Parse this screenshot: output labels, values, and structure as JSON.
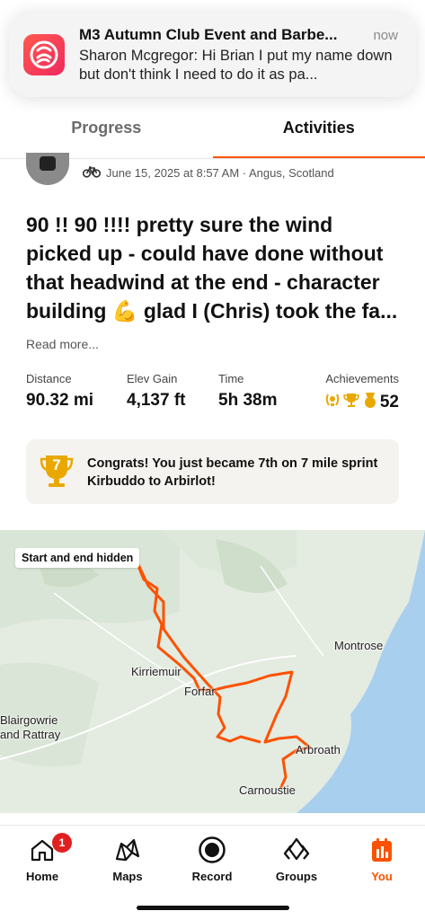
{
  "notification": {
    "title": "M3 Autumn Club Event and Barbe...",
    "time": "now",
    "body": "Sharon Mcgregor: Hi Brian I put my name down but don't think I need to do it as pa..."
  },
  "tabs": [
    {
      "label": "Progress",
      "active": false
    },
    {
      "label": "Activities",
      "active": true
    }
  ],
  "activity": {
    "meta": "June 15, 2025 at 8:57 AM · Angus, Scotland",
    "title_part1": "90 !! 90 !!!! pretty sure the wind picked up - could have done without that headwind at the end - character building",
    "title_emoji": "💪",
    "title_part2": "glad I (Chris) took the fa...",
    "read_more": "Read more..."
  },
  "stats": [
    {
      "label": "Distance",
      "value": "90.32 mi"
    },
    {
      "label": "Elev Gain",
      "value": "4,137 ft"
    },
    {
      "label": "Time",
      "value": "5h 38m"
    },
    {
      "label": "Achievements",
      "value": "52"
    }
  ],
  "achievement_banner": {
    "rank": "7",
    "text": "Congrats! You just became 7th on 7 mile sprint Kirbuddo to Arbirlot!"
  },
  "map": {
    "badge": "Start and end hidden",
    "places": [
      "Montrose",
      "Kirriemuir",
      "Forfar",
      "Blairgowrie",
      "and Rattray",
      "Arbroath",
      "Carnoustie"
    ],
    "route_color": "#fc5200",
    "sea_color": "#a9cfee"
  },
  "bottom_nav": [
    {
      "label": "Home",
      "icon": "home-icon",
      "badge": "1"
    },
    {
      "label": "Maps",
      "icon": "maps-icon"
    },
    {
      "label": "Record",
      "icon": "record-icon"
    },
    {
      "label": "Groups",
      "icon": "groups-icon"
    },
    {
      "label": "You",
      "icon": "you-icon",
      "active": true
    }
  ],
  "colors": {
    "accent": "#fc5200",
    "badge": "#e02020"
  }
}
